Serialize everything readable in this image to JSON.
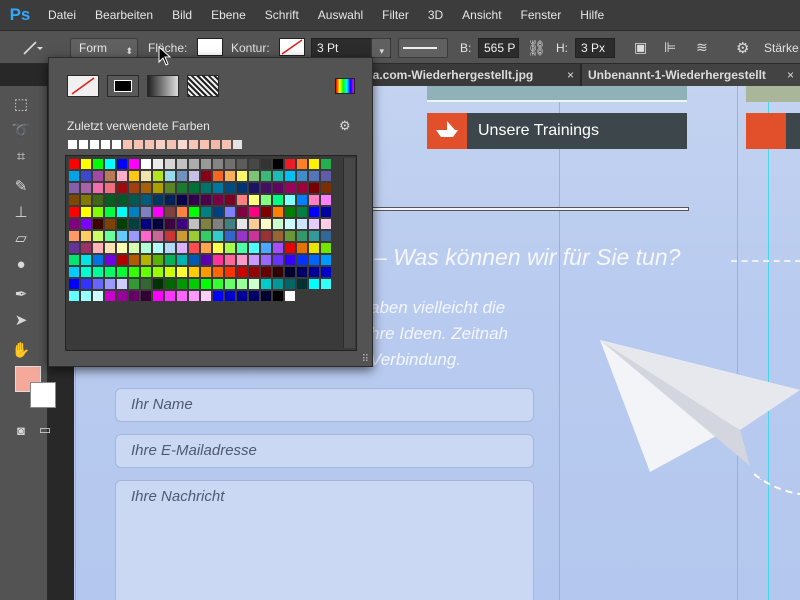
{
  "app": {
    "logo": "Ps"
  },
  "menu": [
    "Datei",
    "Bearbeiten",
    "Bild",
    "Ebene",
    "Schrift",
    "Auswahl",
    "Filter",
    "3D",
    "Ansicht",
    "Fenster",
    "Hilfe"
  ],
  "options": {
    "mode": "Form",
    "fill_label": "Fläche:",
    "stroke_label": "Kontur:",
    "stroke_width": "3 Pt",
    "w_label": "B:",
    "w_value": "565 P",
    "h_label": "H:",
    "h_value": "3 Px",
    "weight_label": "Stärke"
  },
  "tabs": [
    {
      "label": "lia.com-Wiederhergestellt.jpg",
      "close": "×"
    },
    {
      "label": "Unbenannt-1-Wiederhergestellt",
      "close": "×"
    }
  ],
  "picker": {
    "recent_label": "Zuletzt verwendete Farben",
    "recent_colors": [
      "#ffffff",
      "#ffffff",
      "#ffffff",
      "#ffffff",
      "#ffffff",
      "#f6c3b3",
      "#f6c3b3",
      "#f6c3b3",
      "#f8d0c3",
      "#f6c3b3",
      "#f9d8cd",
      "#f7c6b6",
      "#f6c3b3",
      "#f4b8a7",
      "#f6c3b3",
      "#e3e3e3"
    ],
    "grid_colors": [
      "#ff0000",
      "#ffff00",
      "#00ff00",
      "#00ffff",
      "#0000ff",
      "#ff00ff",
      "#ffffff",
      "#ebebeb",
      "#d6d6d6",
      "#c2c2c2",
      "#adadad",
      "#999999",
      "#858585",
      "#707070",
      "#5c5c5c",
      "#474747",
      "#333333",
      "#000000",
      "#ed1c24",
      "#ff7f27",
      "#fff200",
      "#22b14c",
      "#00a2e8",
      "#3f48cc",
      "#a349a4",
      "#b97a57",
      "#ffaec9",
      "#ffc90e",
      "#efe4b0",
      "#b5e61d",
      "#99d9ea",
      "#7092be",
      "#c8bfe7",
      "#880015",
      "#f26522",
      "#fbaf5d",
      "#fff568",
      "#7cc576",
      "#3bb878",
      "#1cbbb4",
      "#00bff3",
      "#438ccb",
      "#5574b9",
      "#605ca8",
      "#855fa8",
      "#a763a8",
      "#f06ea9",
      "#f26d7d",
      "#9e0b0f",
      "#a0410d",
      "#a36209",
      "#aba000",
      "#598527",
      "#1a7b30",
      "#007236",
      "#00746b",
      "#0076a3",
      "#004b80",
      "#003471",
      "#1b1464",
      "#440e62",
      "#630460",
      "#9e005d",
      "#9e0039",
      "#790000",
      "#7b2e00",
      "#7d4900",
      "#827b00",
      "#406618",
      "#005e20",
      "#005826",
      "#005952",
      "#005b7f",
      "#003663",
      "#002157",
      "#0d004c",
      "#32004b",
      "#4b0049",
      "#7b0046",
      "#7a0026",
      "#ff8080",
      "#ffff80",
      "#80ff80",
      "#00ff80",
      "#80ffff",
      "#0080ff",
      "#ff80c0",
      "#ff80ff",
      "#ff0000",
      "#ffff00",
      "#80ff00",
      "#00ff40",
      "#00ffff",
      "#0080c0",
      "#8080c0",
      "#ff00ff",
      "#804040",
      "#ff8040",
      "#00ff00",
      "#008080",
      "#004080",
      "#8080ff",
      "#800040",
      "#ff0080",
      "#800000",
      "#ff8000",
      "#008000",
      "#008040",
      "#0000ff",
      "#0000a0",
      "#800080",
      "#8000ff",
      "#400000",
      "#804000",
      "#004000",
      "#004040",
      "#000080",
      "#000040",
      "#400040",
      "#400080",
      "#c0c0c0",
      "#808040",
      "#808080",
      "#408080",
      "#e6e6e6",
      "#ffcc99",
      "#ffffcc",
      "#ccffcc",
      "#ccffff",
      "#cce5ff",
      "#e5ccff",
      "#ffcce5",
      "#ff9966",
      "#ffcc66",
      "#ccff66",
      "#66ff99",
      "#66ccff",
      "#9999ff",
      "#ff66cc",
      "#cc6699",
      "#cc3333",
      "#cc9933",
      "#99cc33",
      "#33cc66",
      "#33cccc",
      "#3366cc",
      "#9933cc",
      "#cc3399",
      "#993333",
      "#996633",
      "#669933",
      "#339966",
      "#339999",
      "#336699",
      "#663399",
      "#993366",
      "#ffb3b3",
      "#ffe0b3",
      "#ffffb3",
      "#d9ffb3",
      "#b3ffd9",
      "#b3ffff",
      "#b3d9ff",
      "#d9b3ff",
      "#ff4d4d",
      "#ffa64d",
      "#ffff4d",
      "#a6ff4d",
      "#4dffa6",
      "#4dffff",
      "#4da6ff",
      "#a64dff",
      "#e60000",
      "#e67300",
      "#e6e600",
      "#73e600",
      "#00e673",
      "#00e6e6",
      "#0073e6",
      "#7300e6",
      "#b30000",
      "#b35900",
      "#b3b300",
      "#59b300",
      "#00b359",
      "#00b3b3",
      "#0059b3",
      "#5900b3",
      "#ff3399",
      "#ff6699",
      "#ff99cc",
      "#cc99ff",
      "#9966ff",
      "#6633ff",
      "#3300ff",
      "#0033ff",
      "#0066ff",
      "#0099ff",
      "#00ccff",
      "#00ffcc",
      "#00ff99",
      "#00ff66",
      "#00ff33",
      "#33ff00",
      "#66ff00",
      "#99ff00",
      "#ccff00",
      "#ffff33",
      "#ffcc00",
      "#ff9900",
      "#ff6600",
      "#ff3300",
      "#cc0000",
      "#990000",
      "#660000",
      "#330000",
      "#000033",
      "#000066",
      "#000099",
      "#0000cc",
      "#0000ff",
      "#3333ff",
      "#6666ff",
      "#9999ff",
      "#ccccff",
      "#339933",
      "#336633",
      "#003300",
      "#006600",
      "#009900",
      "#00cc00",
      "#00ff00",
      "#33ff33",
      "#66ff66",
      "#99ff99",
      "#ccffcc",
      "#00cccc",
      "#009999",
      "#006666",
      "#003333",
      "#00ffff",
      "#33ffff",
      "#66ffff",
      "#99ffff",
      "#ccffff",
      "#cc00cc",
      "#990099",
      "#660066",
      "#330033",
      "#ff00ff",
      "#ff33ff",
      "#ff66ff",
      "#ff99ff",
      "#ffccff",
      "#0000ff",
      "#0000cc",
      "#000099",
      "#000066",
      "#000033",
      "#000000",
      "#ffffff"
    ]
  },
  "web": {
    "banner_text": "Unsere Trainings",
    "heading": "– Was können wir für Sie tun?",
    "body_lines": [
      "aben vielleicht die",
      "hre Ideen. Zeitnah",
      "Verbindung."
    ],
    "fields": [
      "Ihr Name",
      "Ihre E-Mailadresse",
      "Ihre Nachricht"
    ]
  },
  "colors": {
    "fg": "#f5a99a",
    "bg": "#ffffff",
    "accent": "#31a8ff",
    "banner_icon": "#e2502b"
  }
}
